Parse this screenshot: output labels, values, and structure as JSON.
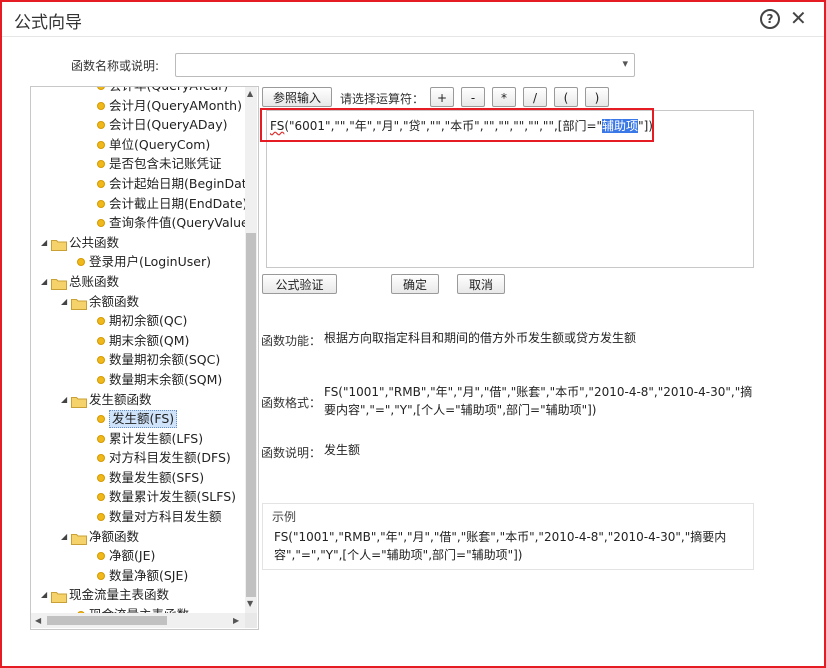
{
  "window": {
    "title": "公式向导"
  },
  "function_name": {
    "label": "函数名称或说明:",
    "value": ""
  },
  "tree": [
    {
      "label": "会计年(QueryAYear)",
      "type": "leaf",
      "indent": 3
    },
    {
      "label": "会计月(QueryAMonth)",
      "type": "leaf",
      "indent": 3
    },
    {
      "label": "会计日(QueryADay)",
      "type": "leaf",
      "indent": 3
    },
    {
      "label": "单位(QueryCom)",
      "type": "leaf",
      "indent": 3
    },
    {
      "label": "是否包含未记账凭证",
      "type": "leaf",
      "indent": 3
    },
    {
      "label": "会计起始日期(BeginDate)",
      "type": "leaf",
      "indent": 3
    },
    {
      "label": "会计截止日期(EndDate)",
      "type": "leaf",
      "indent": 3
    },
    {
      "label": "查询条件值(QueryValue)",
      "type": "leaf",
      "indent": 3
    },
    {
      "label": "公共函数",
      "type": "folder",
      "indent": 1
    },
    {
      "label": "登录用户(LoginUser)",
      "type": "leaf",
      "indent": 2
    },
    {
      "label": "总账函数",
      "type": "folder",
      "indent": 1
    },
    {
      "label": "余额函数",
      "type": "folder",
      "indent": 2
    },
    {
      "label": "期初余额(QC)",
      "type": "leaf",
      "indent": 3
    },
    {
      "label": "期末余额(QM)",
      "type": "leaf",
      "indent": 3
    },
    {
      "label": "数量期初余额(SQC)",
      "type": "leaf",
      "indent": 3
    },
    {
      "label": "数量期末余额(SQM)",
      "type": "leaf",
      "indent": 3
    },
    {
      "label": "发生额函数",
      "type": "folder",
      "indent": 2
    },
    {
      "label": "发生额(FS)",
      "type": "leaf",
      "indent": 3,
      "selected": true
    },
    {
      "label": "累计发生额(LFS)",
      "type": "leaf",
      "indent": 3
    },
    {
      "label": "对方科目发生额(DFS)",
      "type": "leaf",
      "indent": 3
    },
    {
      "label": "数量发生额(SFS)",
      "type": "leaf",
      "indent": 3
    },
    {
      "label": "数量累计发生额(SLFS)",
      "type": "leaf",
      "indent": 3
    },
    {
      "label": "数量对方科目发生额",
      "type": "leaf",
      "indent": 3
    },
    {
      "label": "净额函数",
      "type": "folder",
      "indent": 2
    },
    {
      "label": "净额(JE)",
      "type": "leaf",
      "indent": 3
    },
    {
      "label": "数量净额(SJE)",
      "type": "leaf",
      "indent": 3
    },
    {
      "label": "现金流量主表函数",
      "type": "folder",
      "indent": 1
    },
    {
      "label": "现金流量主表函数",
      "type": "leaf",
      "indent": 2
    }
  ],
  "toolbar": {
    "reference_input": "参照输入",
    "operator_label": "请选择运算符：",
    "operators": [
      "+",
      "-",
      "*",
      "/",
      "(",
      ")"
    ]
  },
  "editor": {
    "prefix": "FS",
    "middle": "(\"6001\",\"\",\"年\",\"月\",\"贷\",\"\",\"本币\",\"\",\"\",\"\",\"\",\"\",[部门=\"",
    "highlight": "辅助项",
    "suffix": "\"])"
  },
  "actions": {
    "validate": "公式验证",
    "ok": "确定",
    "cancel": "取消"
  },
  "info": {
    "function_label": "函数功能：",
    "function_value": "根据方向取指定科目和期间的借方外币发生额或贷方发生额",
    "format_label": "函数格式：",
    "format_value": "FS(\"1001\",\"RMB\",\"年\",\"月\",\"借\",\"账套\",\"本币\",\"2010-4-8\",\"2010-4-30\",\"摘要内容\",\"=\",\"Y\",[个人=\"辅助项\",部门=\"辅助项\"])",
    "desc_label": "函数说明：",
    "desc_value": "发生额"
  },
  "example": {
    "title": "示例",
    "text": "FS(\"1001\",\"RMB\",\"年\",\"月\",\"借\",\"账套\",\"本币\",\"2010-4-8\",\"2010-4-30\",\"摘要内容\",\"=\",\"Y\",[个人=\"辅助项\",部门=\"辅助项\"])"
  },
  "icons": {
    "help": "help-icon",
    "close": "close-icon",
    "folder": "folder-icon",
    "leaf": "function-dot-icon"
  },
  "colors": {
    "highlight_border": "#e51c23",
    "selection": "#3b78e7",
    "folder": "#f6d26b",
    "leaf_dot": "#f0b81a"
  }
}
